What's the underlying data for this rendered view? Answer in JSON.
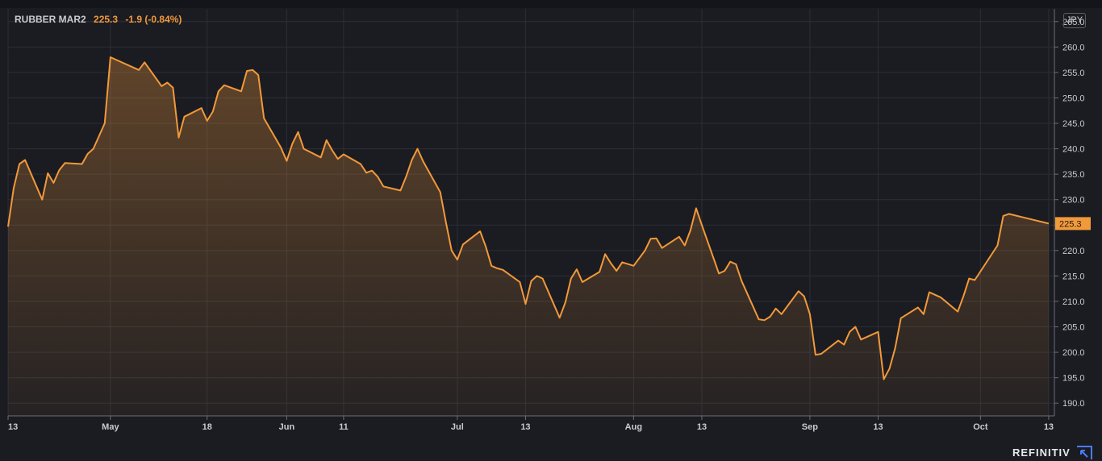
{
  "legend": {
    "symbol": "RUBBER MAR2",
    "last": "225.3",
    "change": "-1.9 (-0.84%)"
  },
  "currency": "JPY",
  "brand": "REFINITIV",
  "colors": {
    "line": "#f2993a",
    "background": "#1b1c22",
    "grid": "#2c2e36",
    "axis_text": "#c9cbd1"
  },
  "chart_data": {
    "type": "area",
    "title": "",
    "xlabel": "",
    "ylabel": "",
    "ylim": [
      187.5,
      267.5
    ],
    "yticks": [
      190,
      195,
      200,
      205,
      210,
      215,
      220,
      225,
      230,
      235,
      240,
      245,
      250,
      255,
      260,
      265
    ],
    "ytick_labels": [
      "190.0",
      "195.0",
      "200.0",
      "205.0",
      "210.0",
      "215.0",
      "220.0",
      "225.0",
      "230.0",
      "235.0",
      "240.0",
      "245.0",
      "250.0",
      "255.0",
      "260.0",
      "265.0"
    ],
    "xlim": [
      "2021-04-13",
      "2021-10-14"
    ],
    "xticks": [
      {
        "date": "2021-04-13",
        "label": "13"
      },
      {
        "date": "2021-05-01",
        "label": "May"
      },
      {
        "date": "2021-05-18",
        "label": "18"
      },
      {
        "date": "2021-06-01",
        "label": "Jun"
      },
      {
        "date": "2021-06-11",
        "label": "11"
      },
      {
        "date": "2021-07-01",
        "label": "Jul"
      },
      {
        "date": "2021-07-13",
        "label": "13"
      },
      {
        "date": "2021-08-01",
        "label": "Aug"
      },
      {
        "date": "2021-08-13",
        "label": "13"
      },
      {
        "date": "2021-09-01",
        "label": "Sep"
      },
      {
        "date": "2021-09-13",
        "label": "13"
      },
      {
        "date": "2021-10-01",
        "label": "Oct"
      },
      {
        "date": "2021-10-13",
        "label": "13"
      }
    ],
    "last_value_label": "225.3",
    "grid": true,
    "series": [
      {
        "name": "RUBBER MAR2",
        "points": [
          [
            "2021-04-13",
            224.7
          ],
          [
            "2021-04-14",
            232.3
          ],
          [
            "2021-04-15",
            237.0
          ],
          [
            "2021-04-16",
            237.8
          ],
          [
            "2021-04-19",
            230.0
          ],
          [
            "2021-04-20",
            235.2
          ],
          [
            "2021-04-21",
            233.3
          ],
          [
            "2021-04-22",
            235.8
          ],
          [
            "2021-04-23",
            237.2
          ],
          [
            "2021-04-26",
            237.0
          ],
          [
            "2021-04-27",
            239.0
          ],
          [
            "2021-04-28",
            240.0
          ],
          [
            "2021-04-30",
            245.0
          ],
          [
            "2021-05-01",
            258.0
          ],
          [
            "2021-05-06",
            255.5
          ],
          [
            "2021-05-07",
            257.0
          ],
          [
            "2021-05-10",
            252.3
          ],
          [
            "2021-05-11",
            253.0
          ],
          [
            "2021-05-12",
            252.0
          ],
          [
            "2021-05-13",
            242.2
          ],
          [
            "2021-05-14",
            246.3
          ],
          [
            "2021-05-17",
            248.0
          ],
          [
            "2021-05-18",
            245.5
          ],
          [
            "2021-05-19",
            247.3
          ],
          [
            "2021-05-20",
            251.3
          ],
          [
            "2021-05-21",
            252.5
          ],
          [
            "2021-05-24",
            251.3
          ],
          [
            "2021-05-25",
            255.3
          ],
          [
            "2021-05-26",
            255.5
          ],
          [
            "2021-05-27",
            254.5
          ],
          [
            "2021-05-28",
            246.0
          ],
          [
            "2021-05-31",
            240.2
          ],
          [
            "2021-06-01",
            237.6
          ],
          [
            "2021-06-02",
            241.0
          ],
          [
            "2021-06-03",
            243.3
          ],
          [
            "2021-06-04",
            240.0
          ],
          [
            "2021-06-07",
            238.3
          ],
          [
            "2021-06-08",
            241.7
          ],
          [
            "2021-06-09",
            239.7
          ],
          [
            "2021-06-10",
            238.0
          ],
          [
            "2021-06-11",
            238.9
          ],
          [
            "2021-06-14",
            237.0
          ],
          [
            "2021-06-15",
            235.3
          ],
          [
            "2021-06-16",
            235.7
          ],
          [
            "2021-06-17",
            234.5
          ],
          [
            "2021-06-18",
            232.6
          ],
          [
            "2021-06-21",
            231.8
          ],
          [
            "2021-06-22",
            234.5
          ],
          [
            "2021-06-23",
            237.8
          ],
          [
            "2021-06-24",
            240.0
          ],
          [
            "2021-06-25",
            237.5
          ],
          [
            "2021-06-28",
            231.5
          ],
          [
            "2021-06-29",
            225.5
          ],
          [
            "2021-06-30",
            220.0
          ],
          [
            "2021-07-01",
            218.2
          ],
          [
            "2021-07-02",
            221.2
          ],
          [
            "2021-07-05",
            223.8
          ],
          [
            "2021-07-06",
            220.8
          ],
          [
            "2021-07-07",
            217.0
          ],
          [
            "2021-07-08",
            216.5
          ],
          [
            "2021-07-09",
            216.2
          ],
          [
            "2021-07-12",
            213.8
          ],
          [
            "2021-07-13",
            209.5
          ],
          [
            "2021-07-14",
            214.0
          ],
          [
            "2021-07-15",
            215.0
          ],
          [
            "2021-07-16",
            214.5
          ],
          [
            "2021-07-19",
            206.8
          ],
          [
            "2021-07-20",
            209.8
          ],
          [
            "2021-07-21",
            214.5
          ],
          [
            "2021-07-22",
            216.3
          ],
          [
            "2021-07-23",
            213.8
          ],
          [
            "2021-07-26",
            215.8
          ],
          [
            "2021-07-27",
            219.3
          ],
          [
            "2021-07-28",
            217.5
          ],
          [
            "2021-07-29",
            216.0
          ],
          [
            "2021-07-30",
            217.7
          ],
          [
            "2021-08-01",
            217.0
          ],
          [
            "2021-08-03",
            220.0
          ],
          [
            "2021-08-04",
            222.3
          ],
          [
            "2021-08-05",
            222.4
          ],
          [
            "2021-08-06",
            220.5
          ],
          [
            "2021-08-09",
            222.7
          ],
          [
            "2021-08-10",
            221.0
          ],
          [
            "2021-08-11",
            224.0
          ],
          [
            "2021-08-12",
            228.3
          ],
          [
            "2021-08-13",
            225.0
          ],
          [
            "2021-08-16",
            215.5
          ],
          [
            "2021-08-17",
            216.0
          ],
          [
            "2021-08-18",
            217.8
          ],
          [
            "2021-08-19",
            217.3
          ],
          [
            "2021-08-20",
            214.0
          ],
          [
            "2021-08-23",
            206.5
          ],
          [
            "2021-08-24",
            206.3
          ],
          [
            "2021-08-25",
            207.0
          ],
          [
            "2021-08-26",
            208.6
          ],
          [
            "2021-08-27",
            207.5
          ],
          [
            "2021-08-30",
            212.0
          ],
          [
            "2021-08-31",
            211.0
          ],
          [
            "2021-09-01",
            207.5
          ],
          [
            "2021-09-02",
            199.5
          ],
          [
            "2021-09-03",
            199.7
          ],
          [
            "2021-09-06",
            202.3
          ],
          [
            "2021-09-07",
            201.5
          ],
          [
            "2021-09-08",
            204.0
          ],
          [
            "2021-09-09",
            205.0
          ],
          [
            "2021-09-10",
            202.5
          ],
          [
            "2021-09-13",
            204.0
          ],
          [
            "2021-09-14",
            194.7
          ],
          [
            "2021-09-15",
            196.8
          ],
          [
            "2021-09-16",
            200.8
          ],
          [
            "2021-09-17",
            206.7
          ],
          [
            "2021-09-20",
            208.8
          ],
          [
            "2021-09-21",
            207.5
          ],
          [
            "2021-09-22",
            211.8
          ],
          [
            "2021-09-24",
            210.8
          ],
          [
            "2021-09-27",
            208.0
          ],
          [
            "2021-09-28",
            211.0
          ],
          [
            "2021-09-29",
            214.5
          ],
          [
            "2021-09-30",
            214.2
          ],
          [
            "2021-10-04",
            221.0
          ],
          [
            "2021-10-05",
            226.8
          ],
          [
            "2021-10-06",
            227.2
          ],
          [
            "2021-10-13",
            225.3
          ]
        ]
      }
    ]
  }
}
